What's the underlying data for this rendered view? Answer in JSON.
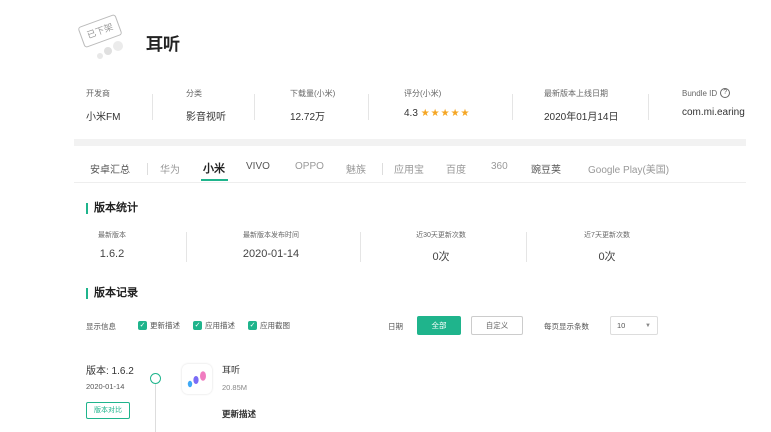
{
  "app": {
    "title": "耳听",
    "stamp": "已下架",
    "icon": "earphone-dots-icon"
  },
  "meta": [
    {
      "label": "开发商",
      "value": "小米FM"
    },
    {
      "label": "分类",
      "value": "影音视听"
    },
    {
      "label": "下载量(小米)",
      "value": "12.72万"
    },
    {
      "label": "评分(小米)",
      "value": "4.3",
      "stars": "★★★★★",
      "rating": 4.3
    },
    {
      "label": "最新版本上线日期",
      "value": "2020年01月14日"
    },
    {
      "label": "Bundle ID",
      "value": "com.mi.earing",
      "help_icon": "?"
    }
  ],
  "tabs": [
    {
      "label": "安卓汇总"
    },
    {
      "label": "华为"
    },
    {
      "label": "小米",
      "active": true
    },
    {
      "label": "VIVO"
    },
    {
      "label": "OPPO"
    },
    {
      "label": "魅族"
    },
    {
      "label": "应用宝"
    },
    {
      "label": "百度"
    },
    {
      "label": "360"
    },
    {
      "label": "豌豆荚"
    },
    {
      "label": "Google Play(美国)"
    }
  ],
  "stats_section": {
    "title": "版本统计",
    "items": [
      {
        "label": "最新版本",
        "value": "1.6.2"
      },
      {
        "label": "最新版本发布时间",
        "value": "2020-01-14"
      },
      {
        "label": "近30天更新次数",
        "value": "0次"
      },
      {
        "label": "近7天更新次数",
        "value": "0次"
      }
    ]
  },
  "records_section": {
    "title": "版本记录",
    "filters": {
      "display_label": "显示信息",
      "checks": [
        "更新描述",
        "应用描述",
        "应用截图"
      ],
      "date_label": "日期",
      "all_button": "全部",
      "custom_button": "自定义",
      "per_page_label": "每页显示条数",
      "per_page_value": "10"
    },
    "record": {
      "version": "版本: 1.6.2",
      "date": "2020-01-14",
      "compare_button": "版本对比",
      "name": "耳听",
      "size": "20.85M",
      "desc_title": "更新描述"
    }
  },
  "colors": {
    "accent": "#1fb48c",
    "star": "#f5a623"
  }
}
